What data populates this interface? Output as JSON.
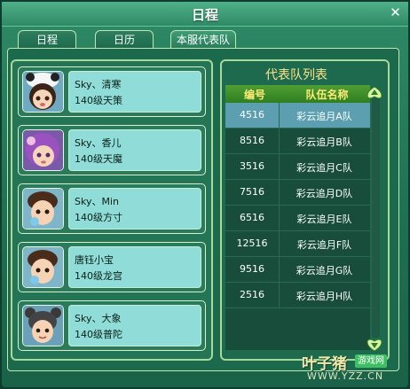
{
  "window": {
    "title": "日程",
    "close_icon": "close-icon"
  },
  "tabs": [
    {
      "label": "日程",
      "active": false
    },
    {
      "label": "日历",
      "active": false
    },
    {
      "label": "本服代表队",
      "active": true
    }
  ],
  "players": [
    {
      "name": "Sky、清寒",
      "level": "140级天策",
      "avatar": "girl-panda-hat"
    },
    {
      "name": "Sky、香儿",
      "level": "140级天魔",
      "avatar": "girl-purple-hair"
    },
    {
      "name": "Sky、Min",
      "level": "140级方寸",
      "avatar": "boy-pacifier"
    },
    {
      "name": "唐钰小宝",
      "level": "140级龙宫",
      "avatar": "boy-pacifier"
    },
    {
      "name": "Sky、大象",
      "level": "140级普陀",
      "avatar": "boy-bear-ears"
    }
  ],
  "team_panel": {
    "title": "代表队列表",
    "headers": [
      "编号",
      "队伍名称"
    ],
    "rows": [
      {
        "id": "4516",
        "name": "彩云追月A队",
        "selected": true
      },
      {
        "id": "8516",
        "name": "彩云追月B队",
        "selected": false
      },
      {
        "id": "3516",
        "name": "彩云追月C队",
        "selected": false
      },
      {
        "id": "7516",
        "name": "彩云追月D队",
        "selected": false
      },
      {
        "id": "6516",
        "name": "彩云追月E队",
        "selected": false
      },
      {
        "id": "12516",
        "name": "彩云追月F队",
        "selected": false
      },
      {
        "id": "9516",
        "name": "彩云追月G队",
        "selected": false
      },
      {
        "id": "2516",
        "name": "彩云追月H队",
        "selected": false
      }
    ]
  },
  "watermark": {
    "brand": "叶子猪",
    "badge": "游戏网",
    "url": "WWW.YZZ.CN"
  },
  "colors": {
    "accent_gold": "#ffe489",
    "header_green": "#4f9e34",
    "selected_row": "#5c9fb0",
    "info_bg": "#8fdcd8"
  }
}
